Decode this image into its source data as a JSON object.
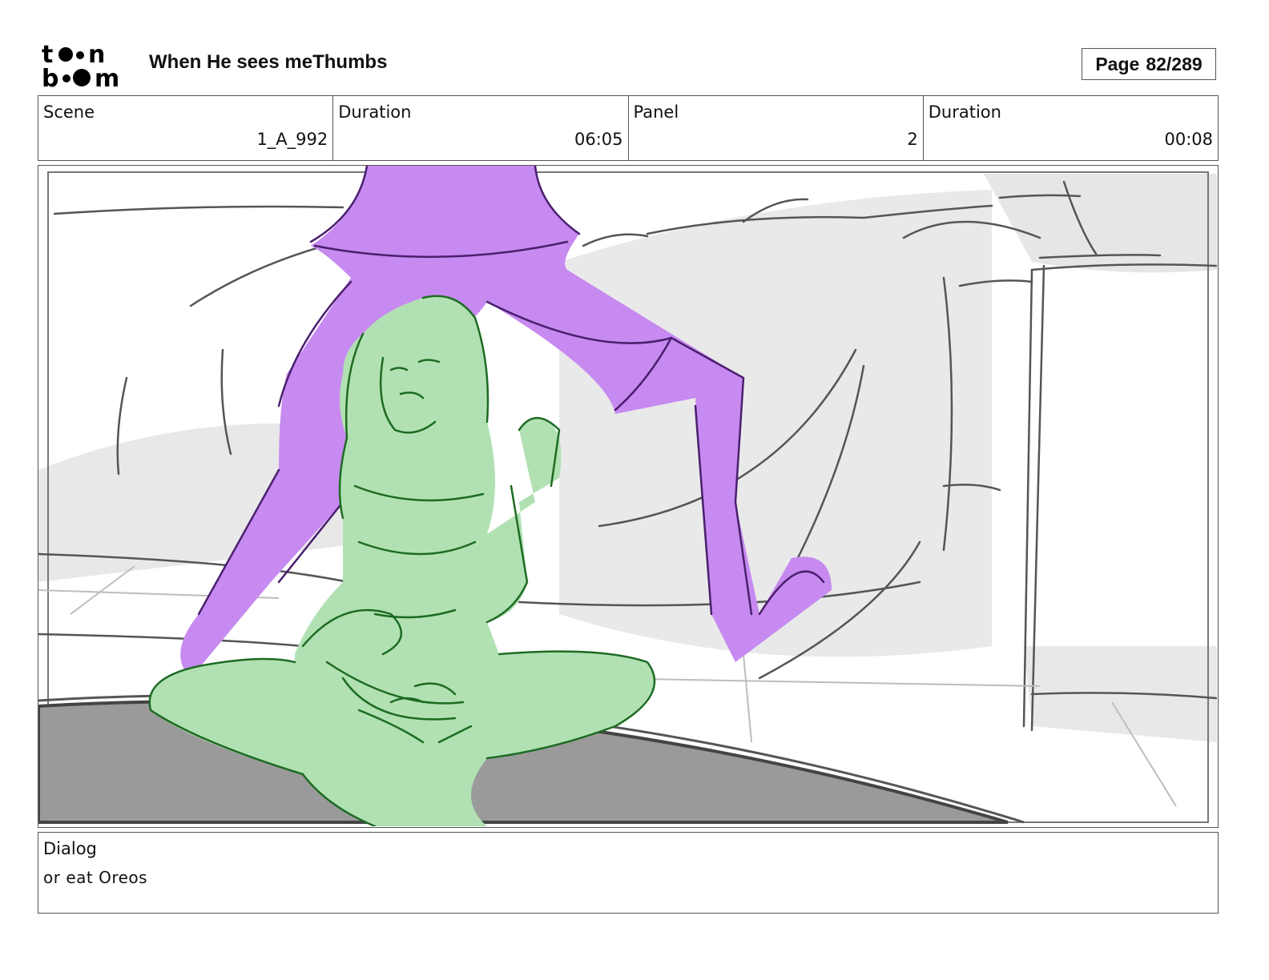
{
  "header": {
    "logo_text_top": "toon",
    "logo_text_bottom": "boom",
    "project_title": "When He sees meThumbs",
    "page_label": "Page",
    "page_value": "82/289"
  },
  "info": [
    {
      "label": "Scene",
      "value": "1_A_992"
    },
    {
      "label": "Duration",
      "value": "06:05"
    },
    {
      "label": "Panel",
      "value": "2"
    },
    {
      "label": "Duration",
      "value": "00:08"
    }
  ],
  "panel": {
    "image_name": "storyboard-panel-drawing",
    "colors": {
      "purple_fill": "#c78af0",
      "purple_line": "#4a1f6e",
      "green_fill": "#b1e1b3",
      "green_line": "#1d6b22",
      "gray_shadow": "#e6e6e6",
      "gray_line": "#555555",
      "floor_dark": "#9a9a9a"
    }
  },
  "dialog": {
    "label": "Dialog",
    "text": "or eat Oreos"
  }
}
